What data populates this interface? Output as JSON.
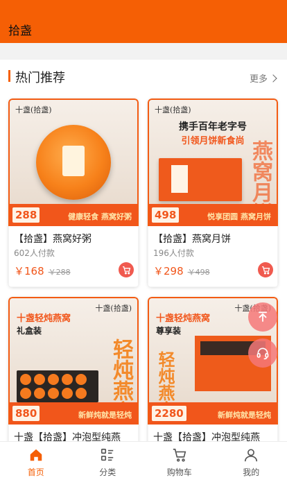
{
  "app": {
    "title": "拾盏"
  },
  "section": {
    "title": "热门推荐",
    "more_label": "更多"
  },
  "products": [
    {
      "poster": {
        "brand": "十盏(拾盏)",
        "price_tag": "288",
        "slogan": "健康轻食 燕窝好粥"
      },
      "name": "【拾盏】燕窝好粥",
      "sold": "602人付款",
      "price": "￥168",
      "old_price": "￥288"
    },
    {
      "poster": {
        "brand": "十盏(拾盏)",
        "headline": "携手百年老字号",
        "subheadline": "引领月饼新食尚",
        "price_tag": "498",
        "slogan": "悦享团圆 燕窝月饼",
        "big_text": "燕窝月饼"
      },
      "name": "【拾盏】燕窝月饼",
      "sold": "196人付款",
      "price": "￥298",
      "old_price": "￥498"
    },
    {
      "poster": {
        "brand": "十盏(拾盏)",
        "headline": "十盏轻炖燕窝",
        "subheadline": "礼盒装",
        "price_tag": "880",
        "slogan": "新鲜炖就是轻炖",
        "big_text": "轻炖燕窝"
      },
      "name": "十盏【拾盏】冲泡型纯燕"
    },
    {
      "poster": {
        "brand": "十盏(拾盏)",
        "headline": "十盏轻炖燕窝",
        "subheadline": "尊享装",
        "price_tag": "2280",
        "slogan": "新鲜炖就是轻炖",
        "big_text": "轻炖燕窝"
      },
      "name": "十盏【拾盏】冲泡型纯燕"
    }
  ],
  "tabbar": [
    {
      "label": "首页",
      "icon": "home-icon",
      "active": true
    },
    {
      "label": "分类",
      "icon": "category-icon",
      "active": false
    },
    {
      "label": "购物车",
      "icon": "cart-icon",
      "active": false
    },
    {
      "label": "我的",
      "icon": "user-icon",
      "active": false
    }
  ],
  "colors": {
    "brand": "#f55f05",
    "price": "#f1561b",
    "cart_button": "#f05a4f"
  }
}
